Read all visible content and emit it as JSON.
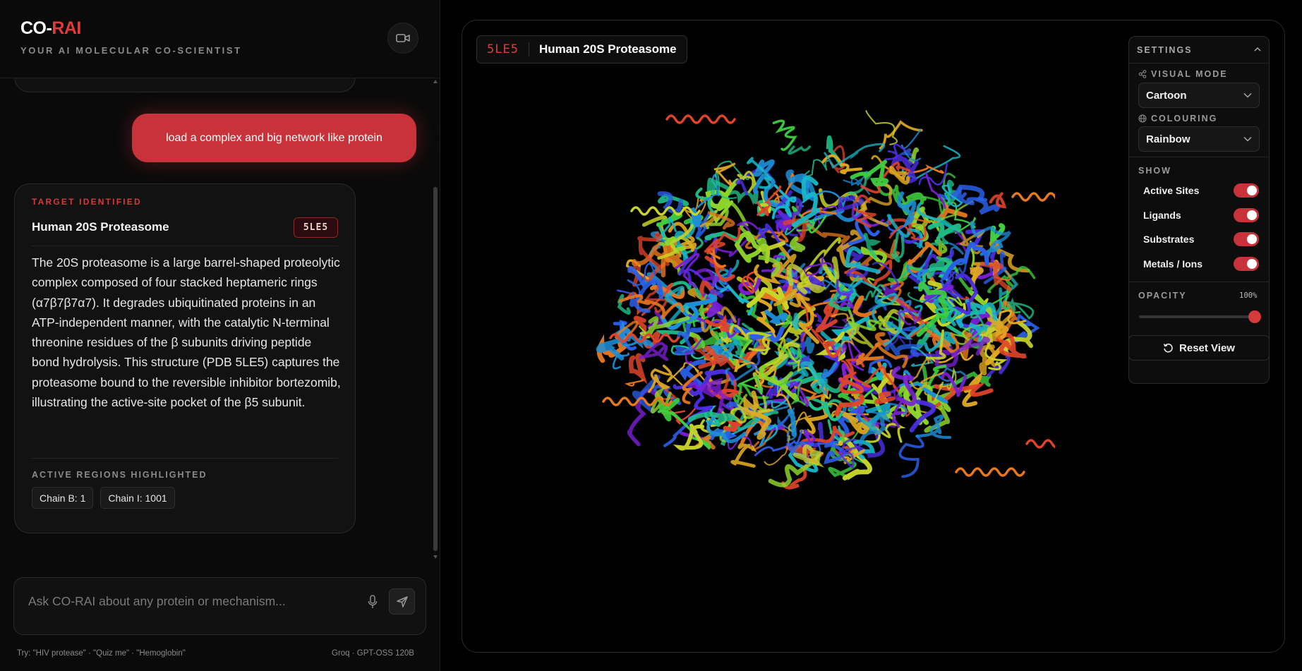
{
  "app": {
    "brand_prefix": "CO-",
    "brand_highlight": "RAI",
    "tagline": "YOUR AI MOLECULAR CO-SCIENTIST",
    "camera_icon": "video-camera-icon"
  },
  "chat": {
    "user_message": "load a complex and big network like protein",
    "ai_card": {
      "kicker": "TARGET IDENTIFIED",
      "title": "Human 20S Proteasome",
      "pdb_badge": "5LE5",
      "body": "The 20S proteasome is a large barrel-shaped proteolytic complex composed of four stacked heptameric rings (α7β7β7α7). It degrades ubiquitinated proteins in an ATP-independent manner, with the catalytic N-terminal threonine residues of the β subunits driving peptide bond hydrolysis. This structure (PDB 5LE5) captures the proteasome bound to the reversible inhibitor bortezomib, illustrating the active-site pocket of the β5 subunit.",
      "regions_label": "ACTIVE REGIONS HIGHLIGHTED",
      "regions": [
        "Chain B: 1",
        "Chain I: 1001"
      ]
    }
  },
  "composer": {
    "placeholder": "Ask CO-RAI about any protein or mechanism...",
    "value": "",
    "mic_icon": "microphone-icon",
    "send_icon": "send-icon",
    "hint": "Try: \"HIV protease\" · \"Quiz me\" · \"Hemoglobin\"",
    "model": "Groq · GPT-OSS 120B"
  },
  "viewer": {
    "pdb_id": "5LE5",
    "structure_name": "Human 20S Proteasome"
  },
  "settings": {
    "title": "SETTINGS",
    "visual_mode_label": "VISUAL MODE",
    "visual_mode_value": "Cartoon",
    "colouring_label": "COLOURING",
    "colouring_value": "Rainbow",
    "show_label": "SHOW",
    "toggles": [
      {
        "label": "Active Sites",
        "on": true
      },
      {
        "label": "Ligands",
        "on": true
      },
      {
        "label": "Substrates",
        "on": true
      },
      {
        "label": "Metals / Ions",
        "on": true
      }
    ],
    "opacity_label": "OPACITY",
    "opacity_value": "100%",
    "opacity_fraction": 1.0,
    "reset_label": "Reset View",
    "accent_color": "#d63a3a"
  }
}
